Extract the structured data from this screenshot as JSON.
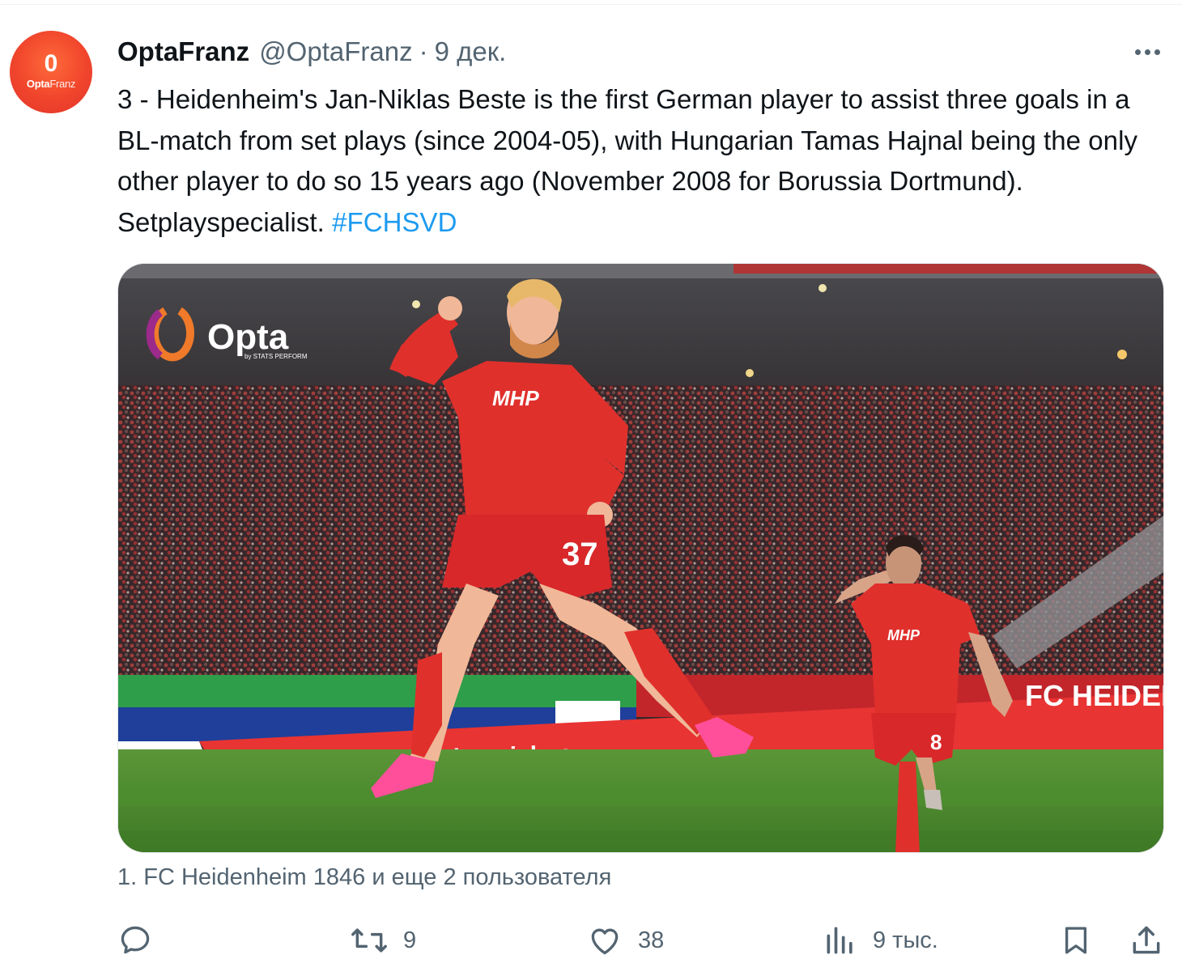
{
  "tweet": {
    "author": {
      "avatar_glyph": "0",
      "avatar_word_bold": "Opta",
      "avatar_word_light": "Franz",
      "display_name": "OptaFranz",
      "handle": "@OptaFranz",
      "separator": "·",
      "date": "9 дек."
    },
    "text_plain": "3 - Heidenheim's Jan-Niklas Beste is the first German player to assist three goals in a BL-match from set plays (since 2004-05), with Hungarian Tamas Hajnal being the only other player to do so 15 years ago (November 2008 for Borussia Dortmund). Setplayspecialist. ",
    "hashtag": "#FCHSVD",
    "media": {
      "logo_word": "Opta",
      "logo_sub": "by STATS PERFORM",
      "sponsor": "MHP",
      "player_number": "37",
      "teammate_number": "8",
      "ad_text": "Jetzt Tickets für Heimspiel ge",
      "board_text": "FC HEIDEN"
    },
    "tagged": "1. FC Heidenheim 1846 и еще 2 пользователя",
    "actions": {
      "reply_icon": "reply-bubble-icon",
      "retweet_icon": "retweet-icon",
      "retweets": "9",
      "like_icon": "heart-icon",
      "likes": "38",
      "views_icon": "bar-chart-icon",
      "views": "9 тыс.",
      "bookmark_icon": "bookmark-icon",
      "share_icon": "share-upload-icon"
    }
  },
  "colors": {
    "hashtag": "#1d9bf0",
    "secondary_text": "#536471",
    "primary_text": "#0f1419",
    "avatar": "#f0452c",
    "kit_red": "#e0302c",
    "pitch": "#4e8a2e"
  }
}
